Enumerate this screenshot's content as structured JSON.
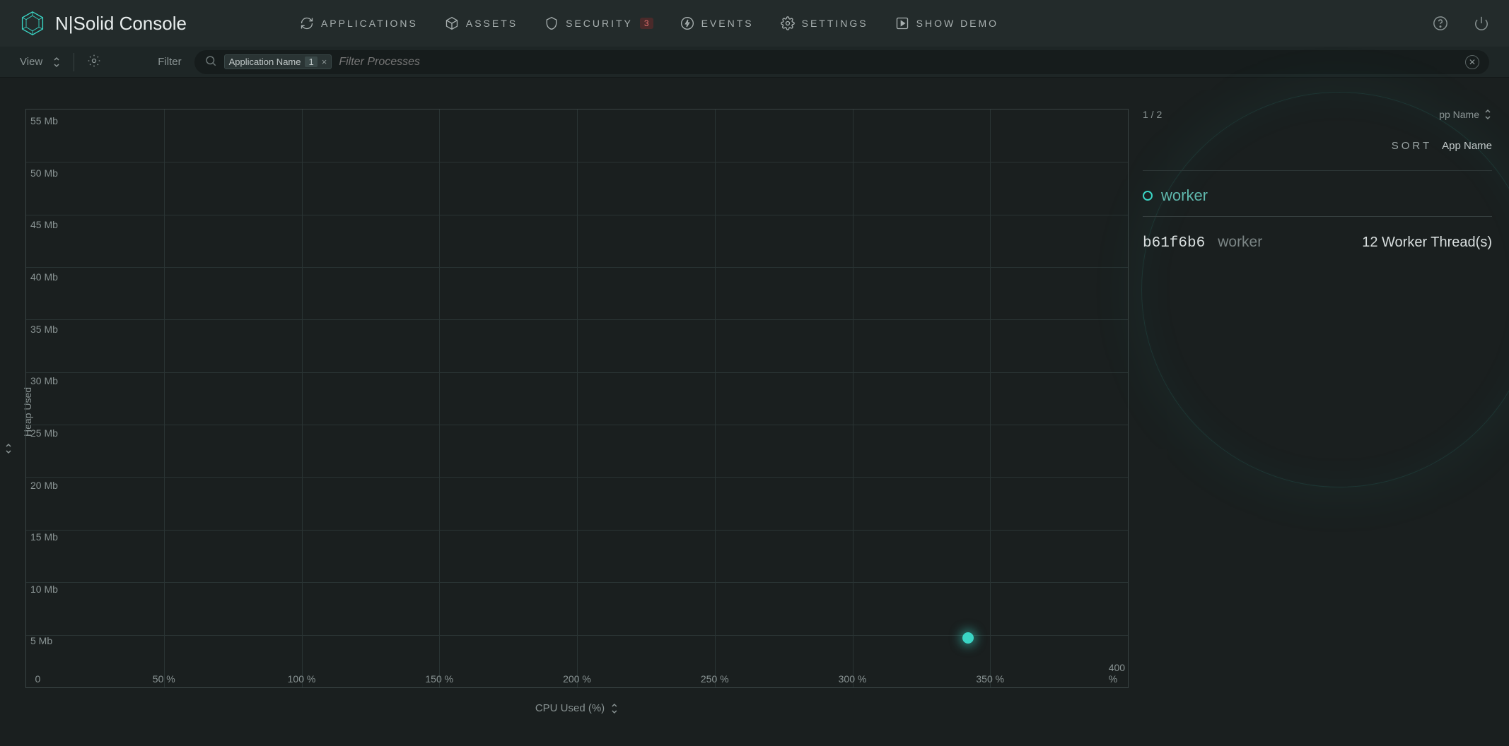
{
  "app_title": "N|Solid Console",
  "nav": {
    "applications": "APPLICATIONS",
    "assets": "ASSETS",
    "security": "SECURITY",
    "security_badge": "3",
    "events": "EVENTS",
    "settings": "SETTINGS",
    "show_demo": "SHOW DEMO"
  },
  "filter_bar": {
    "view_label": "View",
    "filter_label": "Filter",
    "chip_label": "Application Name",
    "chip_count": "1",
    "placeholder": "Filter Processes"
  },
  "chart_data": {
    "type": "scatter",
    "xlabel": "CPU Used (%)",
    "ylabel": "Heap Used",
    "x_ticks": [
      "0",
      "50 %",
      "100 %",
      "150 %",
      "200 %",
      "250 %",
      "300 %",
      "350 %",
      "400 %"
    ],
    "y_ticks": [
      "5 Mb",
      "10 Mb",
      "15 Mb",
      "20 Mb",
      "25 Mb",
      "30 Mb",
      "35 Mb",
      "40 Mb",
      "45 Mb",
      "50 Mb",
      "55 Mb"
    ],
    "xlim": [
      0,
      400
    ],
    "ylim": [
      5,
      55
    ],
    "series": [
      {
        "name": "worker",
        "points": [
          {
            "x": 342,
            "y": 6
          }
        ]
      }
    ]
  },
  "right_panel": {
    "counter": "1 / 2",
    "top_sort_label": "pp Name",
    "sort_label": "SORT",
    "sort_value": "App Name",
    "app_name": "worker",
    "process": {
      "id": "b61f6b6",
      "name": "worker",
      "threads": "12 Worker Thread(s)"
    }
  }
}
